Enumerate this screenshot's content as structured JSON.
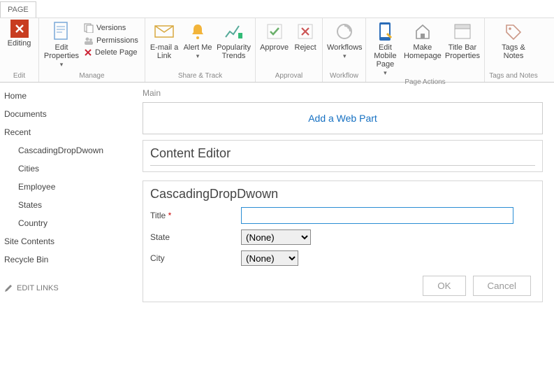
{
  "tab": "PAGE",
  "ribbon": {
    "edit": {
      "stop": "Editing",
      "label": "Edit"
    },
    "manage": {
      "editProps": "Edit Properties",
      "versions": "Versions",
      "permissions": "Permissions",
      "deletePage": "Delete Page",
      "label": "Manage"
    },
    "share": {
      "email": "E-mail a Link",
      "alert": "Alert Me",
      "trends": "Popularity Trends",
      "label": "Share & Track"
    },
    "approval": {
      "approve": "Approve",
      "reject": "Reject",
      "label": "Approval"
    },
    "workflow": {
      "workflows": "Workflows",
      "label": "Workflow"
    },
    "pageActions": {
      "mobile": "Edit Mobile Page",
      "home": "Make Homepage",
      "titlebar": "Title Bar Properties",
      "label": "Page Actions"
    },
    "tagsNotes": {
      "tags": "Tags & Notes",
      "label": "Tags and Notes"
    }
  },
  "sidebar": {
    "home": "Home",
    "documents": "Documents",
    "recent": "Recent",
    "items": [
      {
        "label": "CascadingDropDwown"
      },
      {
        "label": "Cities"
      },
      {
        "label": "Employee"
      },
      {
        "label": "States"
      },
      {
        "label": "Country"
      }
    ],
    "siteContents": "Site Contents",
    "recycleBin": "Recycle Bin",
    "editLinks": "EDIT LINKS"
  },
  "main": {
    "zone": "Main",
    "addWebPart": "Add a Web Part",
    "contentEditor": "Content Editor",
    "form": {
      "title": "CascadingDropDwown",
      "titleLabel": "Title",
      "titleValue": "",
      "state": {
        "label": "State",
        "selected": "(None)"
      },
      "city": {
        "label": "City",
        "selected": "(None)"
      },
      "ok": "OK",
      "cancel": "Cancel"
    }
  },
  "colors": {
    "accent": "#2a8dd4",
    "close": "#c83c20"
  }
}
